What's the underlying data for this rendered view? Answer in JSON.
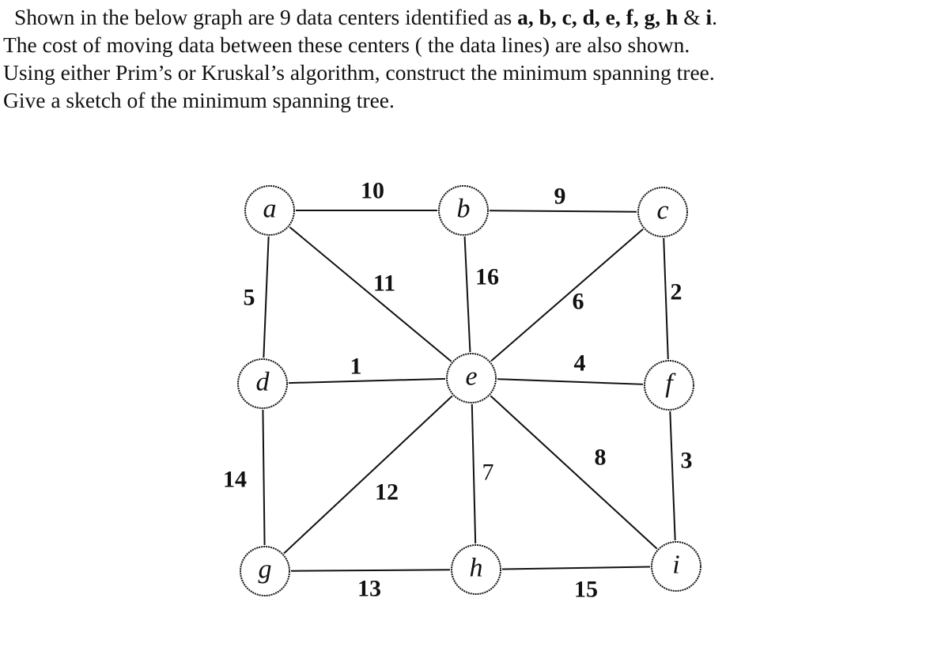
{
  "problem": {
    "line1_prefix": "Shown in the below graph are 9 data centers identified as ",
    "line1_bold": "a, b, c, d, e, f, g, h",
    "line1_amp": " & ",
    "line1_last": "i",
    "line1_end": ".",
    "line2": "The cost of moving data between these centers ( the data lines)  are also shown.",
    "line3": "Using either Prim’s or Kruskal’s algorithm, construct the minimum spanning tree.",
    "line4": "Give a sketch of the minimum spanning tree."
  },
  "graph": {
    "nodes": [
      {
        "id": "a",
        "label": "a"
      },
      {
        "id": "b",
        "label": "b"
      },
      {
        "id": "c",
        "label": "c"
      },
      {
        "id": "d",
        "label": "d"
      },
      {
        "id": "e",
        "label": "e"
      },
      {
        "id": "f",
        "label": "f"
      },
      {
        "id": "g",
        "label": "g"
      },
      {
        "id": "h",
        "label": "h"
      },
      {
        "id": "i",
        "label": "i"
      }
    ],
    "edges": [
      {
        "from": "a",
        "to": "b",
        "weight": "10"
      },
      {
        "from": "b",
        "to": "c",
        "weight": "9"
      },
      {
        "from": "a",
        "to": "d",
        "weight": "5"
      },
      {
        "from": "a",
        "to": "e",
        "weight": "11"
      },
      {
        "from": "b",
        "to": "e",
        "weight": "16"
      },
      {
        "from": "c",
        "to": "e",
        "weight": "6"
      },
      {
        "from": "c",
        "to": "f",
        "weight": "2"
      },
      {
        "from": "d",
        "to": "e",
        "weight": "1"
      },
      {
        "from": "e",
        "to": "f",
        "weight": "4"
      },
      {
        "from": "d",
        "to": "g",
        "weight": "14"
      },
      {
        "from": "e",
        "to": "g",
        "weight": "12"
      },
      {
        "from": "e",
        "to": "h",
        "weight": "7"
      },
      {
        "from": "e",
        "to": "i",
        "weight": "8"
      },
      {
        "from": "f",
        "to": "i",
        "weight": "3"
      },
      {
        "from": "g",
        "to": "h",
        "weight": "13"
      },
      {
        "from": "h",
        "to": "i",
        "weight": "15"
      }
    ]
  }
}
